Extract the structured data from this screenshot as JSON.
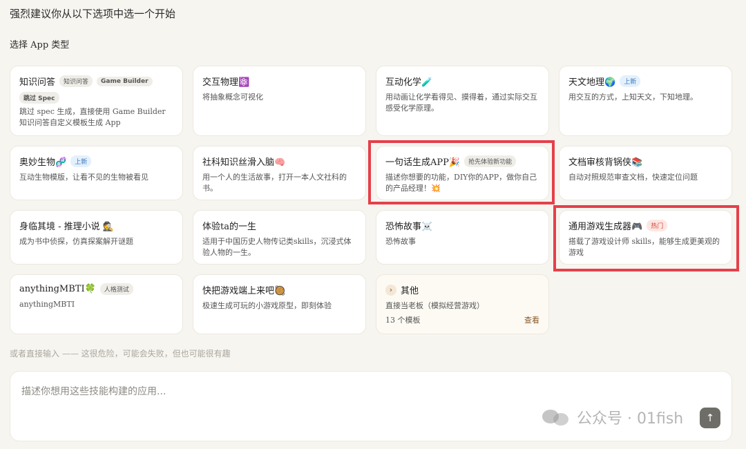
{
  "heading": "强烈建议你从以下选项中选一个开始",
  "subheading": "选择 App 类型",
  "cards": [
    {
      "title": "知识问答",
      "tags": [
        "知识问答",
        "Game Builder",
        "跳过 Spec"
      ],
      "desc": "跳过 spec 生成，直接使用 Game Builder 知识问答自定义模板生成 App"
    },
    {
      "title": "交互物理⚛️",
      "desc": "将抽象概念可视化"
    },
    {
      "title": "互动化学🧪",
      "desc": "用动画让化学看得见、摸得着，通过实际交互感受化学原理。"
    },
    {
      "title": "天文地理🌍",
      "tag": "上新",
      "desc": "用交互的方式，上知天文，下知地理。"
    },
    {
      "title": "奥妙生物🧬",
      "tag": "上新",
      "desc": "互动生物模版，让看不见的生物被看见"
    },
    {
      "title": "社科知识丝滑入脑🧠",
      "desc": "用一个人的生活故事，打开一本人文社科的书。"
    },
    {
      "title": "一句话生成APP🎉",
      "tag": "抢先体验新功能",
      "desc": "描述你想要的功能，DIY你的APP，做你自己的产品经理！💥"
    },
    {
      "title": "文档审核背锅侠📚",
      "desc": "自动对照规范审查文档，快速定位问题"
    },
    {
      "title": "身临其境 - 推理小说 🕵️",
      "desc": "成为书中侦探，仿真探案解开谜题"
    },
    {
      "title": "体验ta的一生",
      "desc": "适用于中国历史人物传记类skills，沉浸式体验人物的一生。"
    },
    {
      "title": "恐怖故事☠️",
      "desc": "恐怖故事"
    },
    {
      "title": "通用游戏生成器🎮",
      "tag": "热门",
      "desc": "搭载了游戏设计师 skills，能够生成更美观的游戏"
    },
    {
      "title": "anythingMBTI🍀",
      "tag": "人格测试",
      "desc": "anythingMBTI"
    },
    {
      "title": "快把游戏端上来吧🥘",
      "desc": "极速生成可玩的小游戏原型，即刻体验"
    }
  ],
  "other": {
    "chevron": "›",
    "title": "其他",
    "desc": "直接当老板（模拟经营游戏）",
    "count": "13 个模板",
    "view": "查看"
  },
  "divider_text": "或者直接输入 —— 这很危险，可能会失败，但也可能很有趣",
  "input": {
    "placeholder": "描述你想用这些技能构建的应用..."
  },
  "send_icon": "↑",
  "watermark": "公众号 · 01fish",
  "colors": {
    "highlight": "#e5404a",
    "tag_new": "#3a78c0",
    "tag_hot": "#d14a36"
  }
}
